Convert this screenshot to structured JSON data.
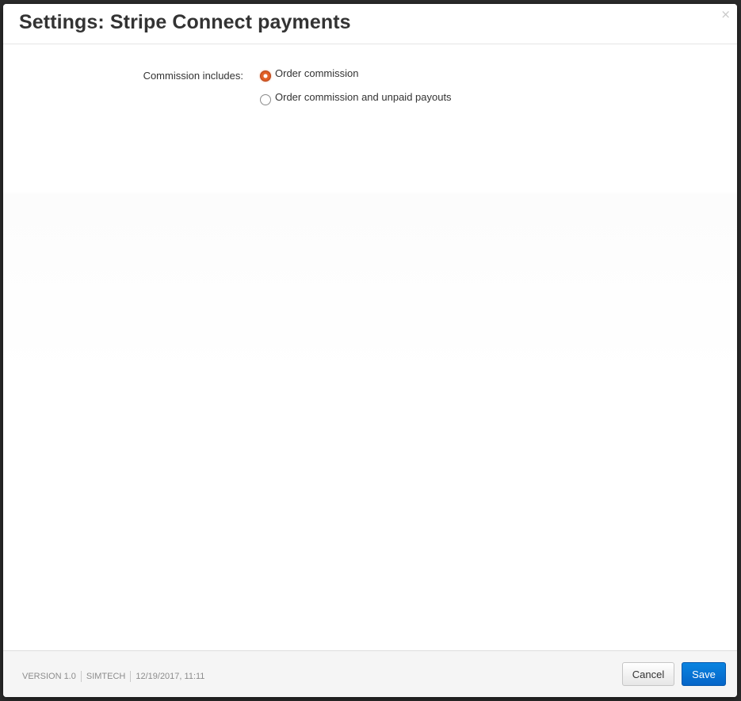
{
  "dialog": {
    "title": "Settings: Stripe Connect payments",
    "close_glyph": "×",
    "close_icon": "close-icon"
  },
  "form": {
    "commission_label": "Commission includes:",
    "options": [
      {
        "label": "Order commission",
        "checked": true
      },
      {
        "label": "Order commission and unpaid payouts",
        "checked": false
      }
    ]
  },
  "footer": {
    "version": "VERSION 1.0",
    "vendor": "SIMTECH",
    "timestamp": "12/19/2017, 11:11",
    "cancel_label": "Cancel",
    "save_label": "Save"
  },
  "colors": {
    "accent_radio": "#e4652b",
    "save_button": "#0a74d8",
    "title_text": "#333333"
  }
}
